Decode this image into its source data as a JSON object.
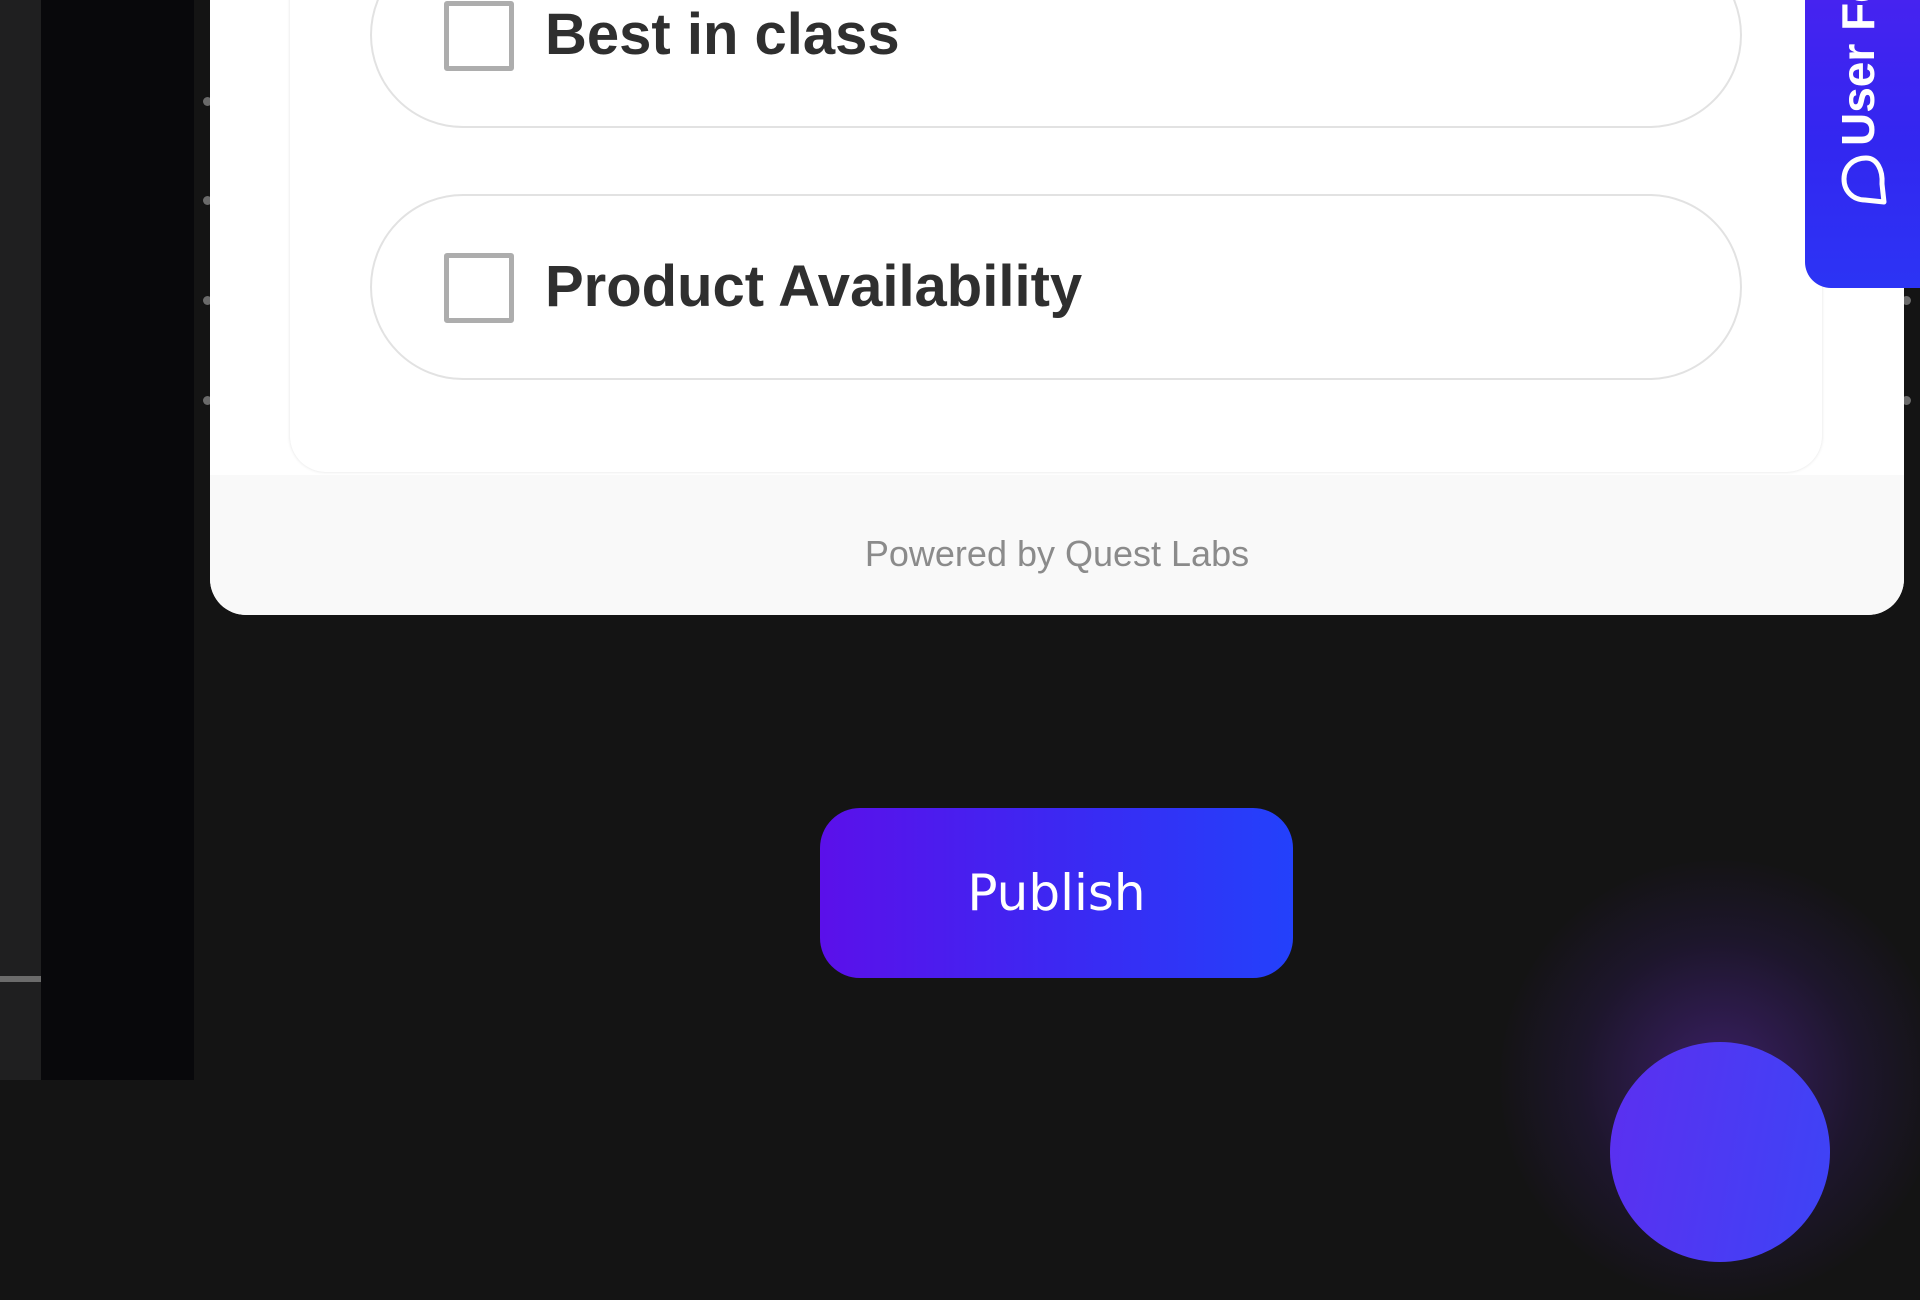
{
  "feedback_widget": {
    "options": [
      {
        "label": "Best in class",
        "checked": false
      },
      {
        "label": "Product Availability",
        "checked": false
      }
    ],
    "powered_by": "Powered by Quest Labs"
  },
  "feedback_tab": {
    "label": "User Fe",
    "icon": "chat-bubble-icon"
  },
  "publish_button": {
    "label": "Publish"
  },
  "colors": {
    "page_background": "#141414",
    "accent_start": "#5b10ea",
    "accent_end": "#2341fb",
    "option_border": "#e2e2e2",
    "checkbox_border": "#adadad",
    "footer_text": "#8b8b8b"
  }
}
